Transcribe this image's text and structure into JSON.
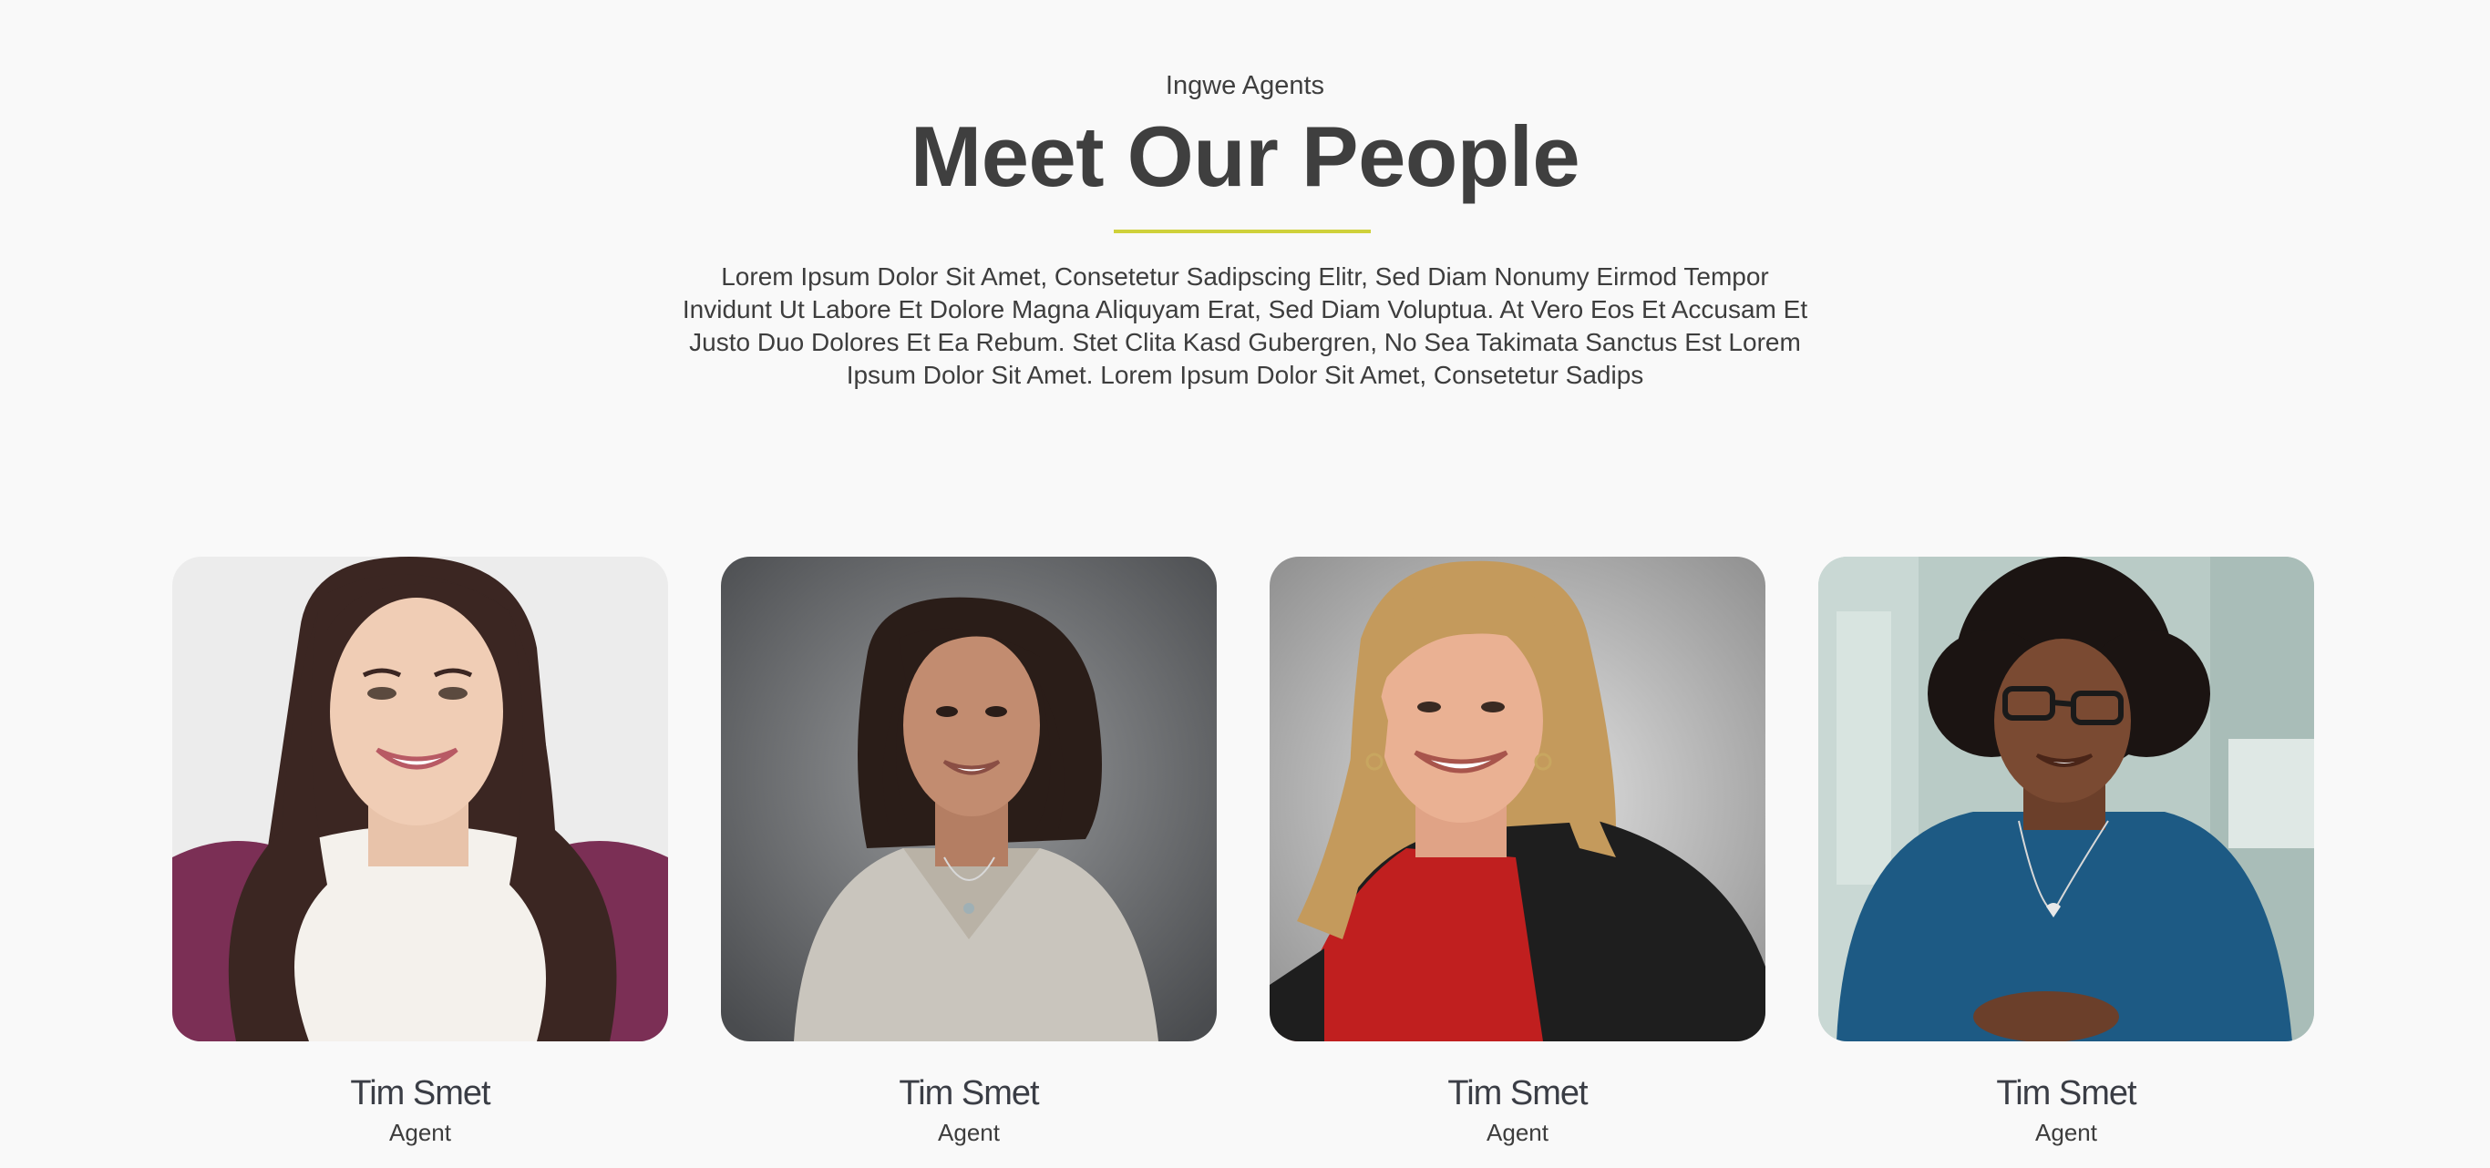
{
  "header": {
    "eyebrow": "Ingwe Agents",
    "title": "Meet Our People",
    "accent_color": "#cfd13b",
    "intro": "Lorem Ipsum Dolor Sit Amet, Consetetur Sadipscing Elitr, Sed Diam Nonumy Eirmod Tempor Invidunt Ut Labore Et Dolore Magna Aliquyam Erat, Sed Diam Voluptua. At Vero Eos Et Accusam Et Justo Duo Dolores Et Ea Rebum. Stet Clita Kasd Gubergren, No Sea Takimata Sanctus Est Lorem Ipsum Dolor Sit Amet. Lorem Ipsum Dolor Sit Amet, Consetetur Sadips"
  },
  "team": [
    {
      "name": "Tim Smet",
      "role": "Agent"
    },
    {
      "name": "Tim Smet",
      "role": "Agent"
    },
    {
      "name": "Tim Smet",
      "role": "Agent"
    },
    {
      "name": "Tim Smet",
      "role": "Agent"
    }
  ]
}
